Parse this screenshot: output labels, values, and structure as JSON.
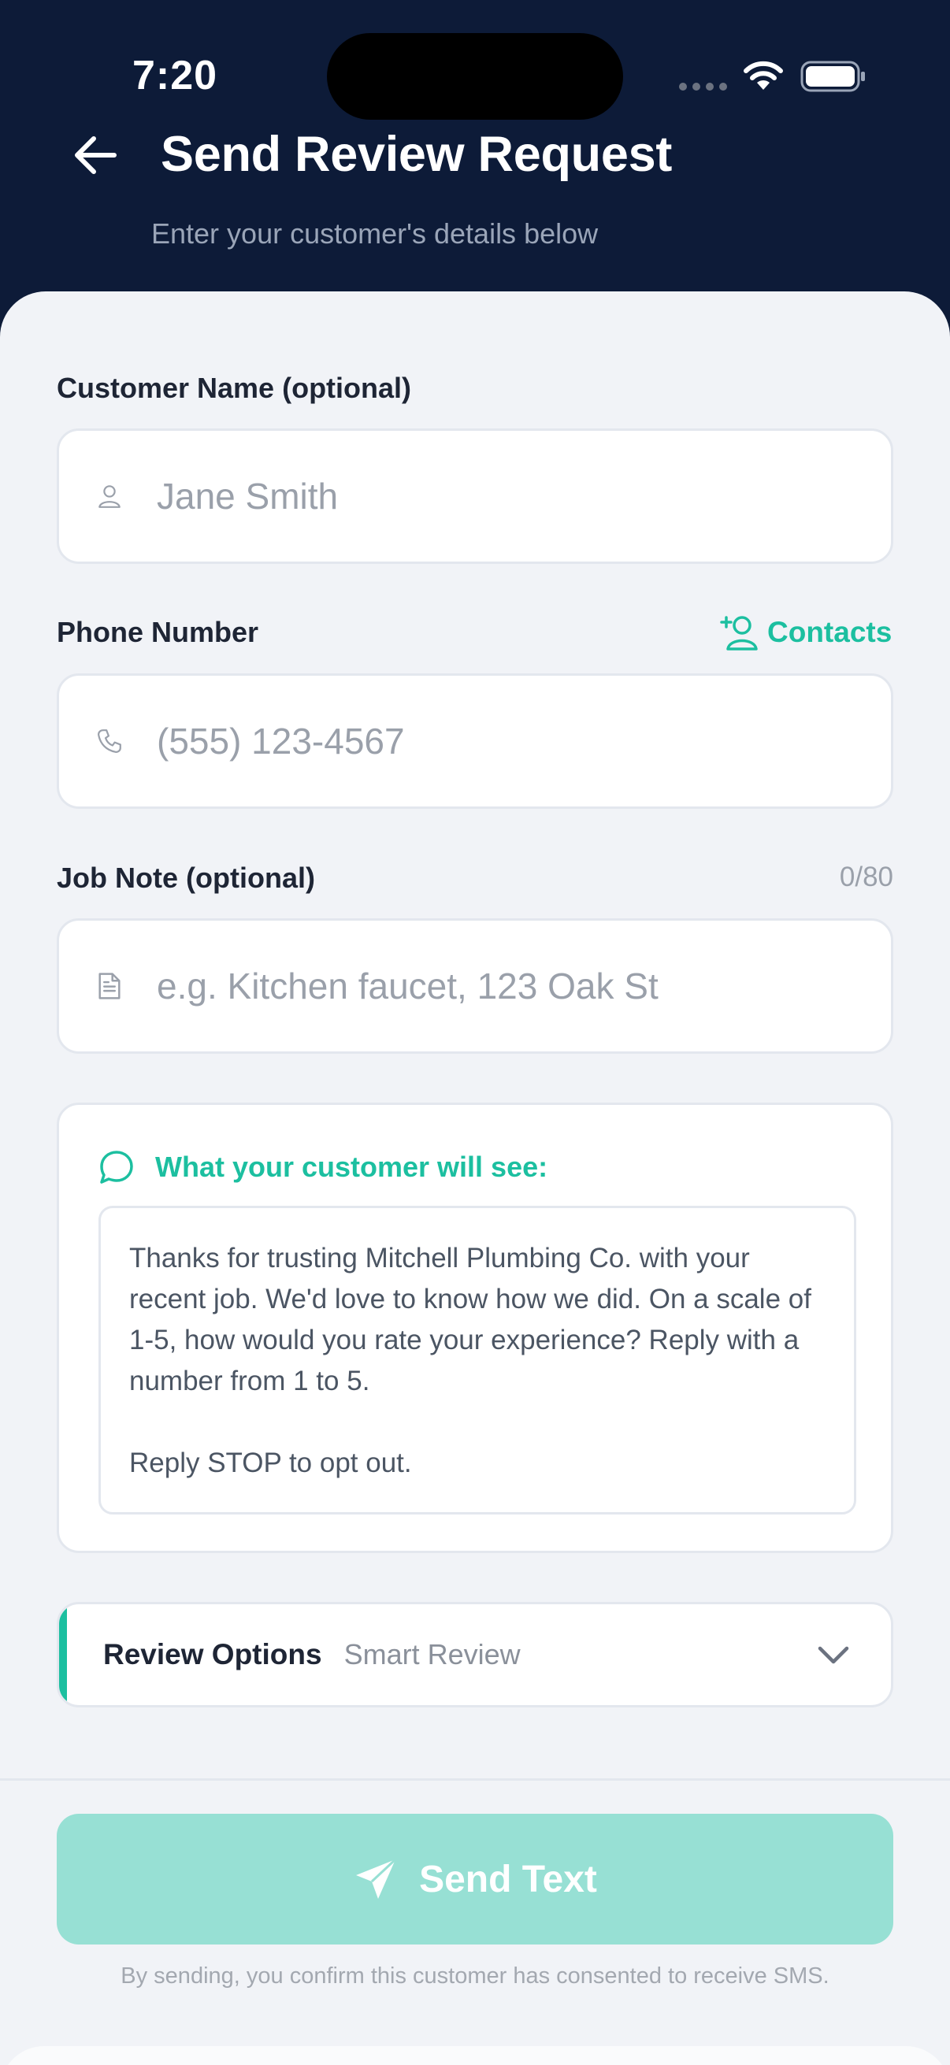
{
  "status_bar": {
    "time": "7:20"
  },
  "header": {
    "title": "Send Review Request",
    "subtitle": "Enter your customer's details below"
  },
  "form": {
    "name": {
      "label": "Customer Name (optional)",
      "placeholder": "Jane Smith",
      "icon": "person-icon"
    },
    "phone": {
      "label": "Phone Number",
      "placeholder": "(555) 123-4567",
      "icon": "phone-icon",
      "contacts_label": "Contacts"
    },
    "note": {
      "label": "Job Note (optional)",
      "counter": "0/80",
      "placeholder": "e.g. Kitchen faucet, 123 Oak St",
      "icon": "document-icon"
    }
  },
  "preview": {
    "heading": "What your customer will see:",
    "message": "Thanks for trusting Mitchell Plumbing Co. with your recent job. We'd love to know how we did. On a scale of 1-5, how would you rate your experience? Reply with a number from 1 to 5.\n\nReply STOP to opt out."
  },
  "review_options": {
    "title": "Review Options",
    "value": "Smart Review"
  },
  "footer": {
    "send_label": "Send Text",
    "consent": "By sending, you confirm this customer has consented to receive SMS."
  },
  "colors": {
    "navy": "#0d1b38",
    "accent": "#1cbfa0",
    "button_disabled": "#97e0d4",
    "background": "#f1f3f7"
  }
}
